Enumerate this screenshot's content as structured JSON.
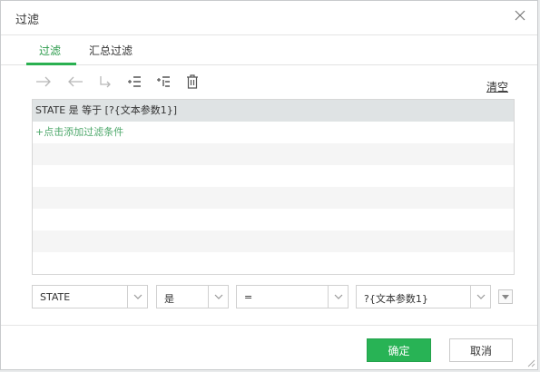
{
  "dialog": {
    "title": "过滤"
  },
  "tabs": [
    {
      "label": "过滤"
    },
    {
      "label": "汇总过滤"
    }
  ],
  "toolbar": {
    "clear_label": "清空",
    "icons": [
      "arrow-right-icon",
      "arrow-left-icon",
      "indent-icon",
      "add-condition-icon",
      "add-subcondition-icon",
      "delete-icon"
    ]
  },
  "conditions": {
    "selected_row": "STATE 是 等于 [?{文本参数1}]",
    "add_link": "+点击添加过滤条件"
  },
  "editor": {
    "field_value": "STATE",
    "operator_value": "是",
    "comparison_value": "=",
    "parameter_value": "?{文本参数1}"
  },
  "buttons": {
    "ok_label": "确定",
    "cancel_label": "取消"
  },
  "colors": {
    "accent": "#2ab050",
    "selected_row": "#dfe3e4",
    "add_link": "#4ea86b"
  }
}
